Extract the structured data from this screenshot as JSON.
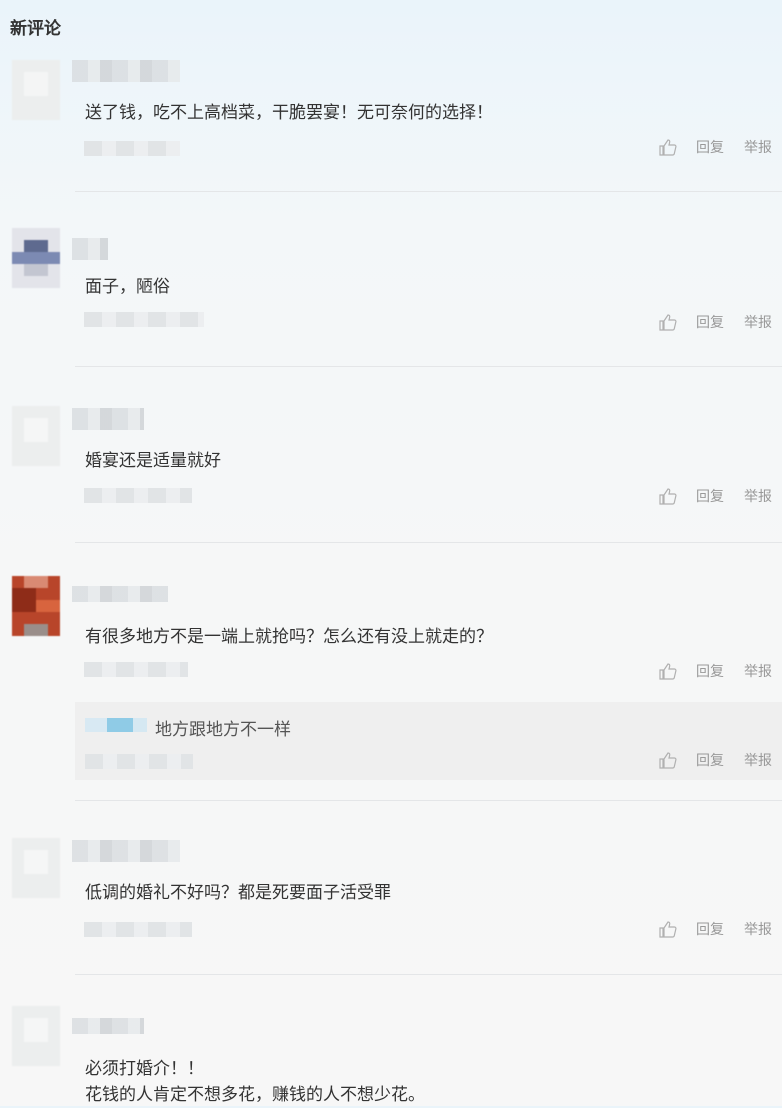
{
  "header": {
    "title": "新评论"
  },
  "labels": {
    "reply": "回复",
    "report": "举报"
  },
  "comments": [
    {
      "text": "送了钱，吃不上高档菜，干脆罢宴！无可奈何的选择！"
    },
    {
      "text": "面子，陋俗"
    },
    {
      "text": "婚宴还是适量就好"
    },
    {
      "text": "有很多地方不是一端上就抢吗？怎么还有没上就走的？",
      "reply": {
        "text": "地方跟地方不一样"
      }
    },
    {
      "text": "低调的婚礼不好吗？都是死要面子活受罪"
    },
    {
      "text": "必须打婚介！！\n花钱的人肯定不想多花，赚钱的人不想少花。"
    }
  ],
  "colors": {
    "text": "#333333",
    "muted": "#999999",
    "reply_bg": "#efefef"
  }
}
